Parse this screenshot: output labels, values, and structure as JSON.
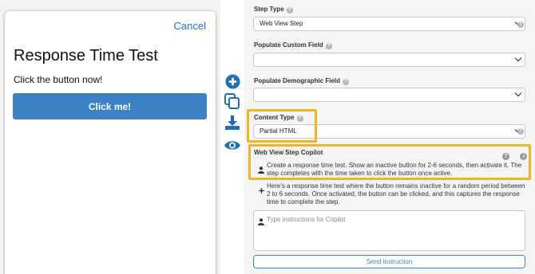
{
  "preview": {
    "cancel_label": "Cancel",
    "title": "Response Time Test",
    "instruction": "Click the button now!",
    "button_label": "Click me!"
  },
  "tools": {
    "icons": [
      "plus-circle-icon",
      "copy-icon",
      "download-icon",
      "eye-icon"
    ],
    "accent": "#1f6fb5"
  },
  "settings": {
    "step_type": {
      "label": "Step Type",
      "value": "Web View Step"
    },
    "custom_field": {
      "label": "Populate Custom Field",
      "value": ""
    },
    "demographic_field": {
      "label": "Populate Demographic Field",
      "value": ""
    },
    "content_type": {
      "label": "Content Type",
      "value": "Partial HTML"
    },
    "help_glyph": "?"
  },
  "copilot": {
    "title": "Web View Step Copilot",
    "user_message": "Create a response time test. Show an inactive button for 2-6 seconds, then activate it. The step completes with the time taken to click the button once active.",
    "ai_message": "Here's a response time test where the button remains inactive for a random period between 2 to 6 seconds. Once activated, the button can be clicked, and this captures the response time to complete the step.",
    "input_placeholder": "Type instructions for Copilot",
    "send_label": "Send instruction",
    "help_glyph": "?",
    "info_glyph": "i"
  },
  "colors": {
    "highlight": "#f0b429",
    "primary": "#3b82c4"
  }
}
